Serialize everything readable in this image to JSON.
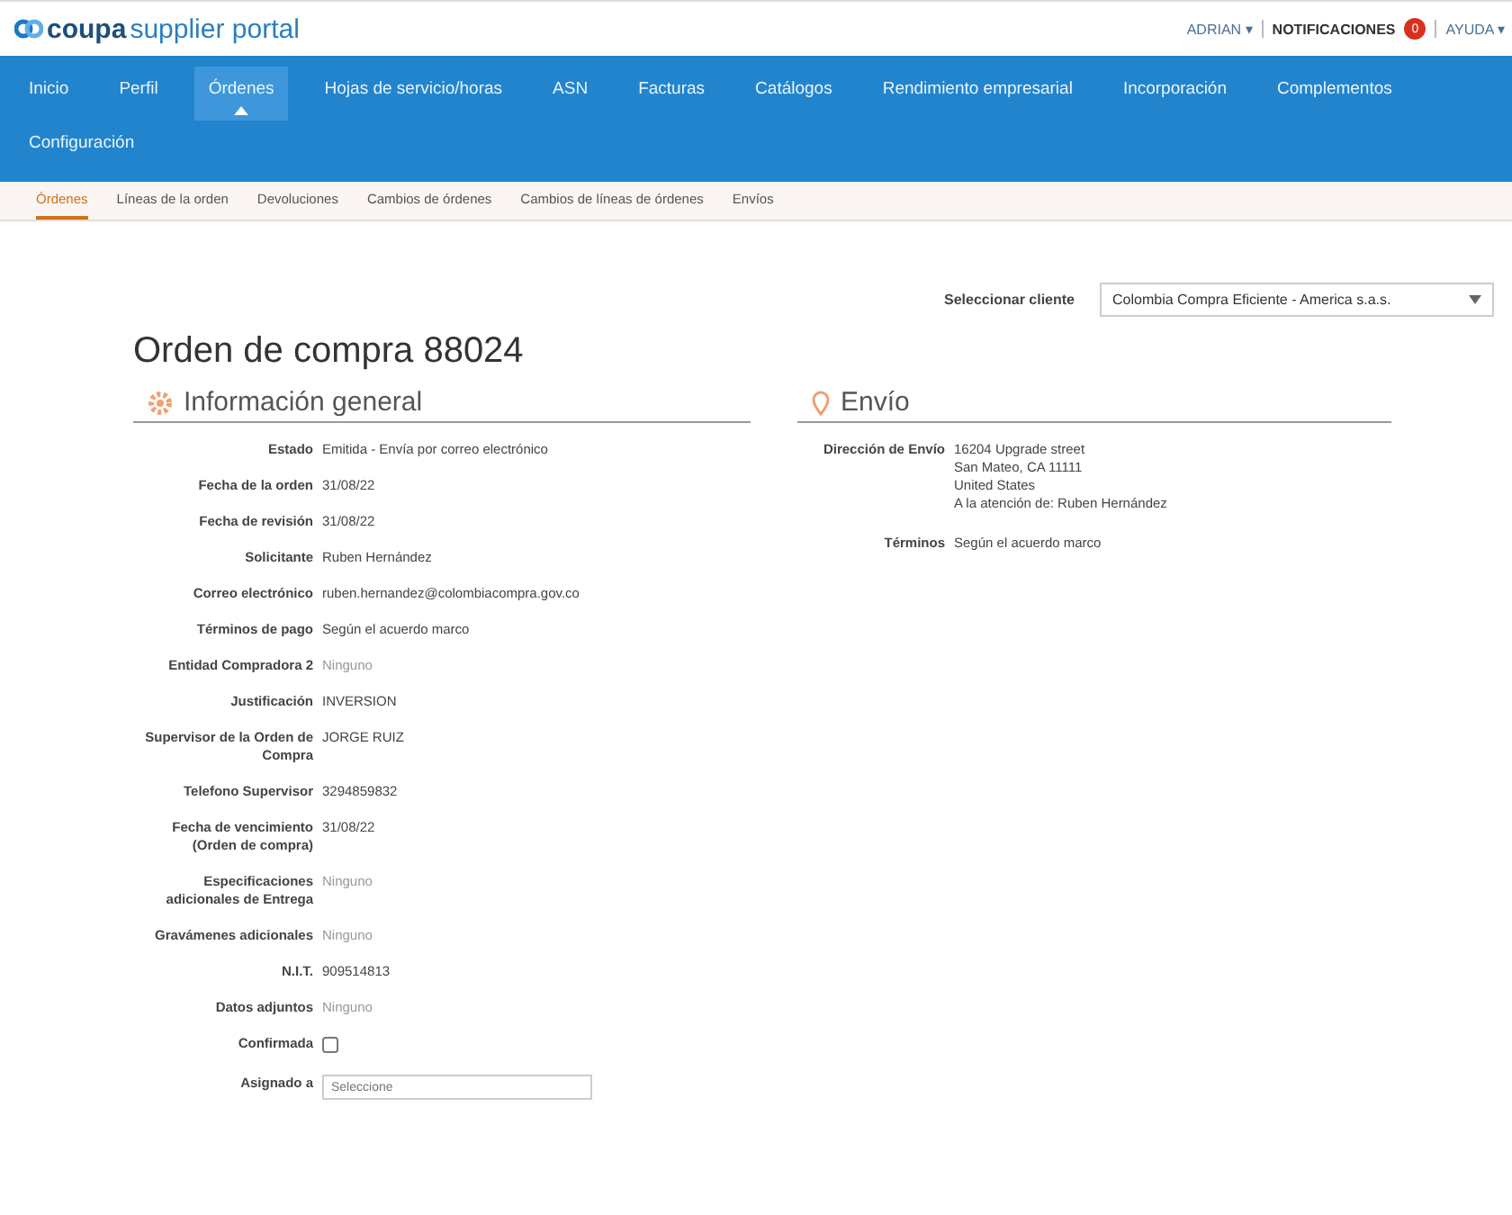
{
  "header": {
    "logo_brand": "coupa",
    "logo_rest": "supplier portal",
    "user_menu": "ADRIAN ▾",
    "notifications": "NOTIFICACIONES",
    "notification_count": "0",
    "help_menu": "AYUDA ▾"
  },
  "nav": [
    {
      "label": "Inicio",
      "selected": false
    },
    {
      "label": "Perfil",
      "selected": false
    },
    {
      "label": "Órdenes",
      "selected": true
    },
    {
      "label": "Hojas de servicio/horas",
      "selected": false
    },
    {
      "label": "ASN",
      "selected": false
    },
    {
      "label": "Facturas",
      "selected": false
    },
    {
      "label": "Catálogos",
      "selected": false
    },
    {
      "label": "Rendimiento empresarial",
      "selected": false
    },
    {
      "label": "Incorporación",
      "selected": false
    },
    {
      "label": "Complementos",
      "selected": false
    },
    {
      "label": "Configuración",
      "selected": false
    }
  ],
  "subnav": [
    {
      "label": "Órdenes",
      "selected": true
    },
    {
      "label": "Líneas de la orden",
      "selected": false
    },
    {
      "label": "Devoluciones",
      "selected": false
    },
    {
      "label": "Cambios de órdenes",
      "selected": false
    },
    {
      "label": "Cambios de líneas de órdenes",
      "selected": false
    },
    {
      "label": "Envíos",
      "selected": false
    }
  ],
  "customer_select": {
    "label": "Seleccionar cliente",
    "value": "Colombia Compra Eficiente - America s.a.s."
  },
  "title": "Orden de compra 88024",
  "general": {
    "heading": "Información general",
    "fields": [
      {
        "kind": "text",
        "label": "Estado",
        "value": "Emitida - Envía por correo electrónico"
      },
      {
        "kind": "text",
        "label": "Fecha de la orden",
        "value": "31/08/22"
      },
      {
        "kind": "text",
        "label": "Fecha de revisión",
        "value": "31/08/22"
      },
      {
        "kind": "text",
        "label": "Solicitante",
        "value": "Ruben Hernández"
      },
      {
        "kind": "text",
        "label": "Correo electrónico",
        "value": "ruben.hernandez@colombiacompra.gov.co"
      },
      {
        "kind": "text",
        "label": "Términos de pago",
        "value": "Según el acuerdo marco"
      },
      {
        "kind": "muted",
        "label": "Entidad Compradora 2",
        "value": "Ninguno"
      },
      {
        "kind": "text",
        "label": "Justificación",
        "value": "INVERSION"
      },
      {
        "kind": "text",
        "label": "Supervisor de la Orden de Compra",
        "value": "JORGE RUIZ"
      },
      {
        "kind": "text",
        "label": "Telefono Supervisor",
        "value": "3294859832"
      },
      {
        "kind": "text",
        "label": "Fecha de vencimiento (Orden de compra)",
        "value": "31/08/22"
      },
      {
        "kind": "muted",
        "label": "Especificaciones adicionales de Entrega",
        "value": "Ninguno"
      },
      {
        "kind": "muted",
        "label": "Gravámenes adicionales",
        "value": "Ninguno"
      },
      {
        "kind": "text",
        "label": "N.I.T.",
        "value": "909514813"
      },
      {
        "kind": "muted",
        "label": "Datos adjuntos",
        "value": "Ninguno"
      },
      {
        "kind": "checkbox",
        "label": "Confirmada",
        "checked": false
      },
      {
        "kind": "input",
        "label": "Asignado a",
        "placeholder": "Seleccione"
      }
    ]
  },
  "shipping": {
    "heading": "Envío",
    "fields": [
      {
        "label": "Dirección de Envío",
        "lines": [
          "16204 Upgrade street",
          "San Mateo, CA 11111",
          "United States",
          "A la atención de: Ruben Hernández"
        ]
      },
      {
        "label": "Términos",
        "lines": [
          "Según el acuerdo marco"
        ]
      }
    ]
  }
}
